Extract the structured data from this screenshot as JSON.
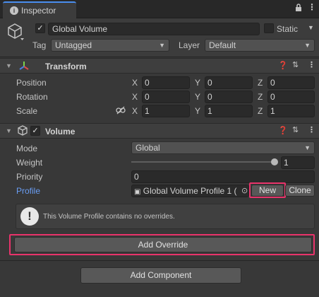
{
  "tab": {
    "icon": "info-circle-icon",
    "title": "Inspector"
  },
  "tab_controls": {
    "lock_icon": "lock-icon",
    "menu_icon": "kebab-menu-icon"
  },
  "gameobject": {
    "icon": "cube-icon",
    "active": true,
    "name": "Global Volume",
    "static_label": "Static",
    "static_checked": false,
    "tag_label": "Tag",
    "tag_value": "Untagged",
    "layer_label": "Layer",
    "layer_value": "Default"
  },
  "transform": {
    "title": "Transform",
    "rows": [
      {
        "label": "Position",
        "x": "0",
        "y": "0",
        "z": "0"
      },
      {
        "label": "Rotation",
        "x": "0",
        "y": "0",
        "z": "0"
      },
      {
        "label": "Scale",
        "x": "1",
        "y": "1",
        "z": "1"
      }
    ],
    "axis_x": "X",
    "axis_y": "Y",
    "axis_z": "Z"
  },
  "volume": {
    "title": "Volume",
    "enabled": true,
    "mode_label": "Mode",
    "mode_value": "Global",
    "weight_label": "Weight",
    "weight_value": "1",
    "weight_fraction": 1.0,
    "priority_label": "Priority",
    "priority_value": "0",
    "profile_label": "Profile",
    "profile_value": "Global Volume Profile 1 (",
    "new_button": "New",
    "clone_button": "Clone",
    "help_text": "This Volume Profile contains no overrides.",
    "add_override": "Add Override"
  },
  "add_component": "Add Component",
  "colors": {
    "accent_blue": "#4a8ef0",
    "highlight_pink": "#e8336b",
    "profile_label": "#6a9ef5"
  }
}
